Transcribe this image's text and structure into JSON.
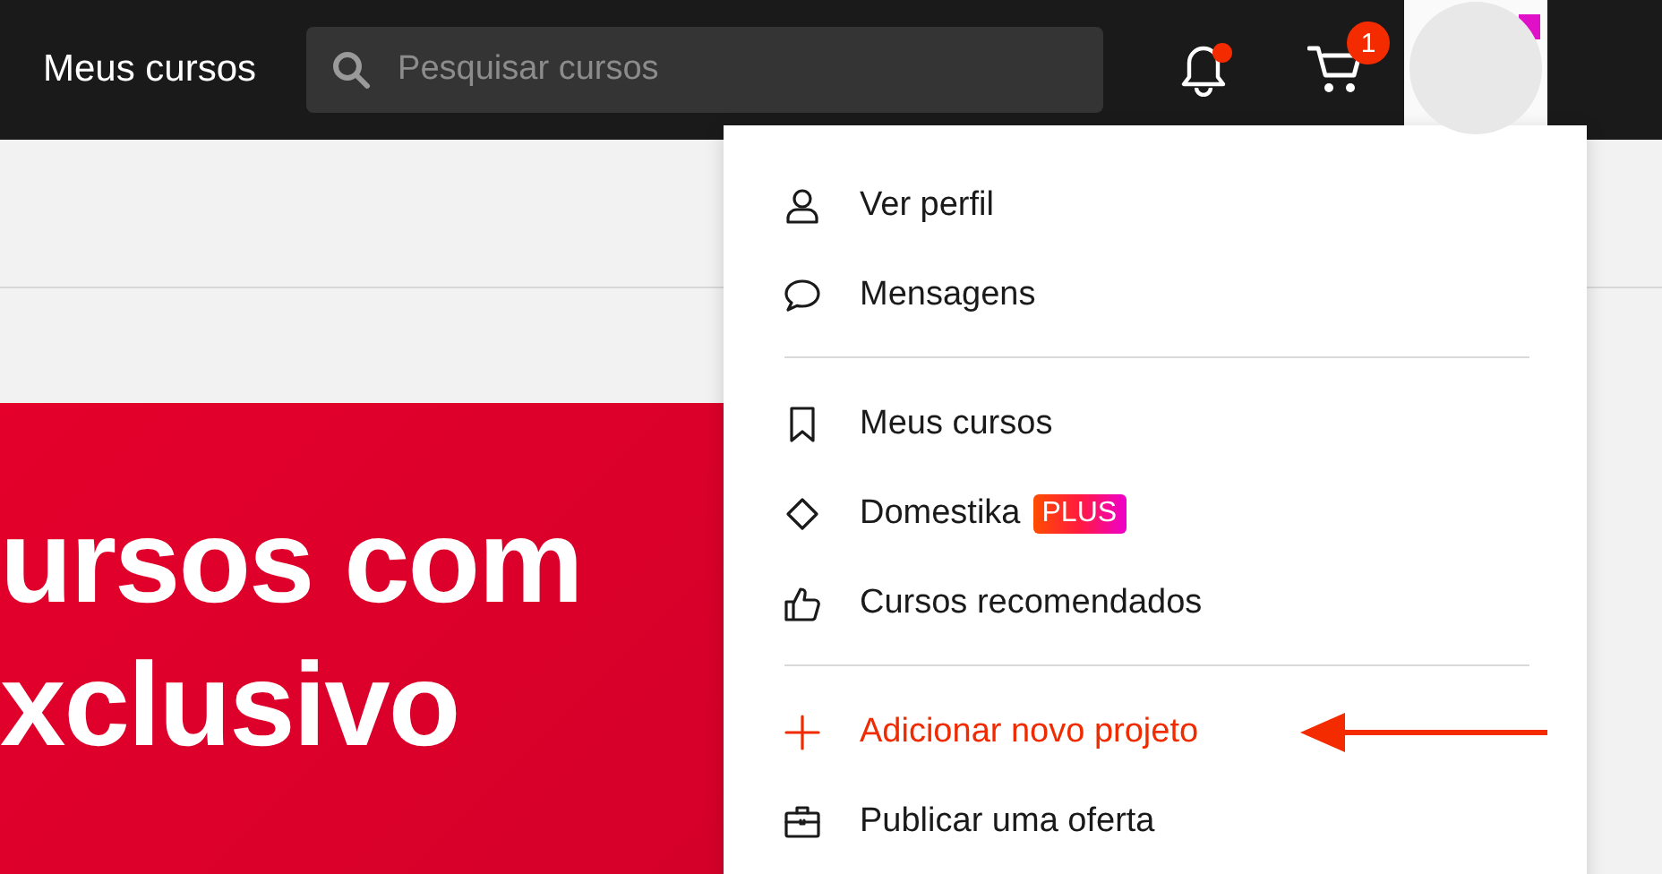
{
  "header": {
    "title": "Meus cursos",
    "search": {
      "placeholder": "Pesquisar cursos"
    },
    "notifications": {
      "unread": true
    },
    "cart": {
      "count": "1"
    }
  },
  "banner": {
    "lines": [
      "ursos com",
      "xclusivo"
    ]
  },
  "menu": {
    "groups": [
      {
        "items": [
          {
            "label": "Ver perfil",
            "kind": "link"
          },
          {
            "label": "Mensagens",
            "kind": "link"
          }
        ]
      },
      {
        "items": [
          {
            "label": "Meus cursos",
            "kind": "link"
          },
          {
            "label": "Domestika",
            "kind": "link",
            "badge": "PLUS"
          },
          {
            "label": "Cursos recomendados",
            "kind": "link"
          }
        ]
      },
      {
        "items": [
          {
            "label": "Adicionar novo projeto",
            "kind": "action"
          },
          {
            "label": "Publicar uma oferta",
            "kind": "link"
          }
        ]
      }
    ]
  }
}
